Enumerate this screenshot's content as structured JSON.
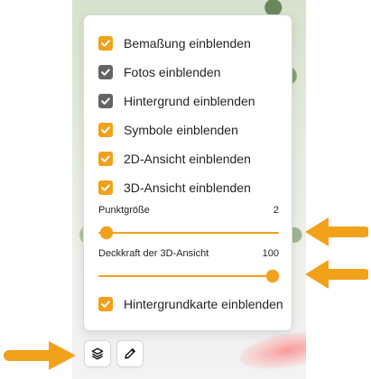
{
  "colors": {
    "accent": "#f2a11a",
    "checked_gray": "#646464",
    "text": "#242424",
    "arrow": "#f2a11a"
  },
  "popup": {
    "checkboxes": [
      {
        "label": "Bemaßung einblenden",
        "checked": true,
        "style": "orange"
      },
      {
        "label": "Fotos einblenden",
        "checked": true,
        "style": "gray"
      },
      {
        "label": "Hintergrund einblenden",
        "checked": true,
        "style": "gray"
      },
      {
        "label": "Symbole einblenden",
        "checked": true,
        "style": "orange"
      },
      {
        "label": "2D-Ansicht einblenden",
        "checked": true,
        "style": "orange"
      },
      {
        "label": "3D-Ansicht einblenden",
        "checked": true,
        "style": "orange"
      }
    ],
    "sliders": [
      {
        "label": "Punktgröße",
        "value_text": "2",
        "value": 2,
        "min": 1,
        "max": 100
      },
      {
        "label": "Deckkraft der 3D-Ansicht",
        "value_text": "100",
        "value": 100,
        "min": 0,
        "max": 100
      }
    ],
    "background_map": {
      "label": "Hintergrundkarte einblenden",
      "checked": true
    }
  },
  "toolbar": {
    "layers_icon": "layers-icon",
    "edit_icon": "pencil-icon"
  },
  "annotations": {
    "arrow_icon": "arrow-icon"
  }
}
